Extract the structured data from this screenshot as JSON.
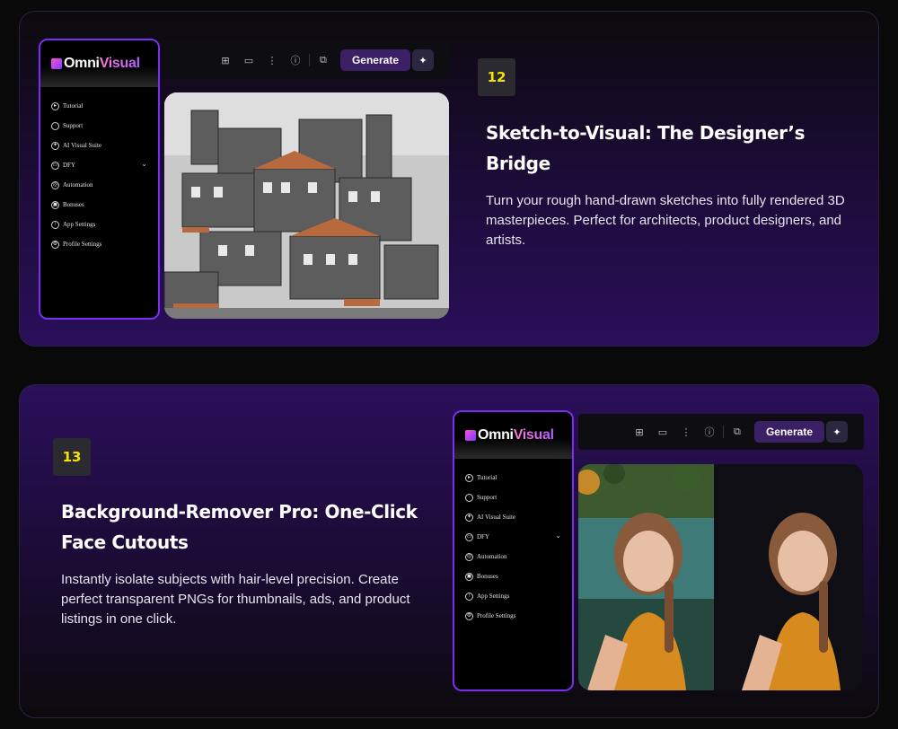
{
  "brand": {
    "name_part1": "Omni",
    "name_part2": "Visual"
  },
  "sidebar_menu": [
    {
      "label": "Tutorial",
      "icon": "play-circle-icon",
      "glyph": "▸"
    },
    {
      "label": "Support",
      "icon": "chat-bubble-icon",
      "glyph": "·"
    },
    {
      "label": "AI Visual Suite",
      "icon": "sparkles-icon",
      "glyph": "✦"
    },
    {
      "label": "DFY",
      "icon": "folder-icon",
      "glyph": "▭"
    },
    {
      "label": "Automation",
      "icon": "automation-icon",
      "glyph": "◎"
    },
    {
      "label": "Bonuses",
      "icon": "gift-icon",
      "glyph": "▣"
    },
    {
      "label": "App Settings",
      "icon": "upload-icon",
      "glyph": "↑"
    },
    {
      "label": "Profile Settings",
      "icon": "gear-icon",
      "glyph": "⚙"
    }
  ],
  "toolbar": {
    "generate_label": "Generate",
    "icons": [
      "image-add-icon",
      "folder-plus-icon",
      "more-vertical-icon",
      "info-icon",
      "copy-icon",
      "sparkle-icon"
    ]
  },
  "features": [
    {
      "number": "12",
      "title": "Sketch-to-Visual: The Designer’s Bridge",
      "description": "Turn your rough hand-drawn sketches into fully rendered 3D masterpieces. Perfect for architects, product designers, and artists."
    },
    {
      "number": "13",
      "title": "Background-Remover Pro: One-Click Face Cutouts",
      "description": "Instantly isolate subjects with hair-level precision. Create perfect transparent PNGs for thumbnails, ads, and product listings in one click."
    }
  ],
  "colors": {
    "accent_purple": "#7d2df0",
    "badge_number": "#f5e400",
    "generate_button": "#3b2066"
  }
}
